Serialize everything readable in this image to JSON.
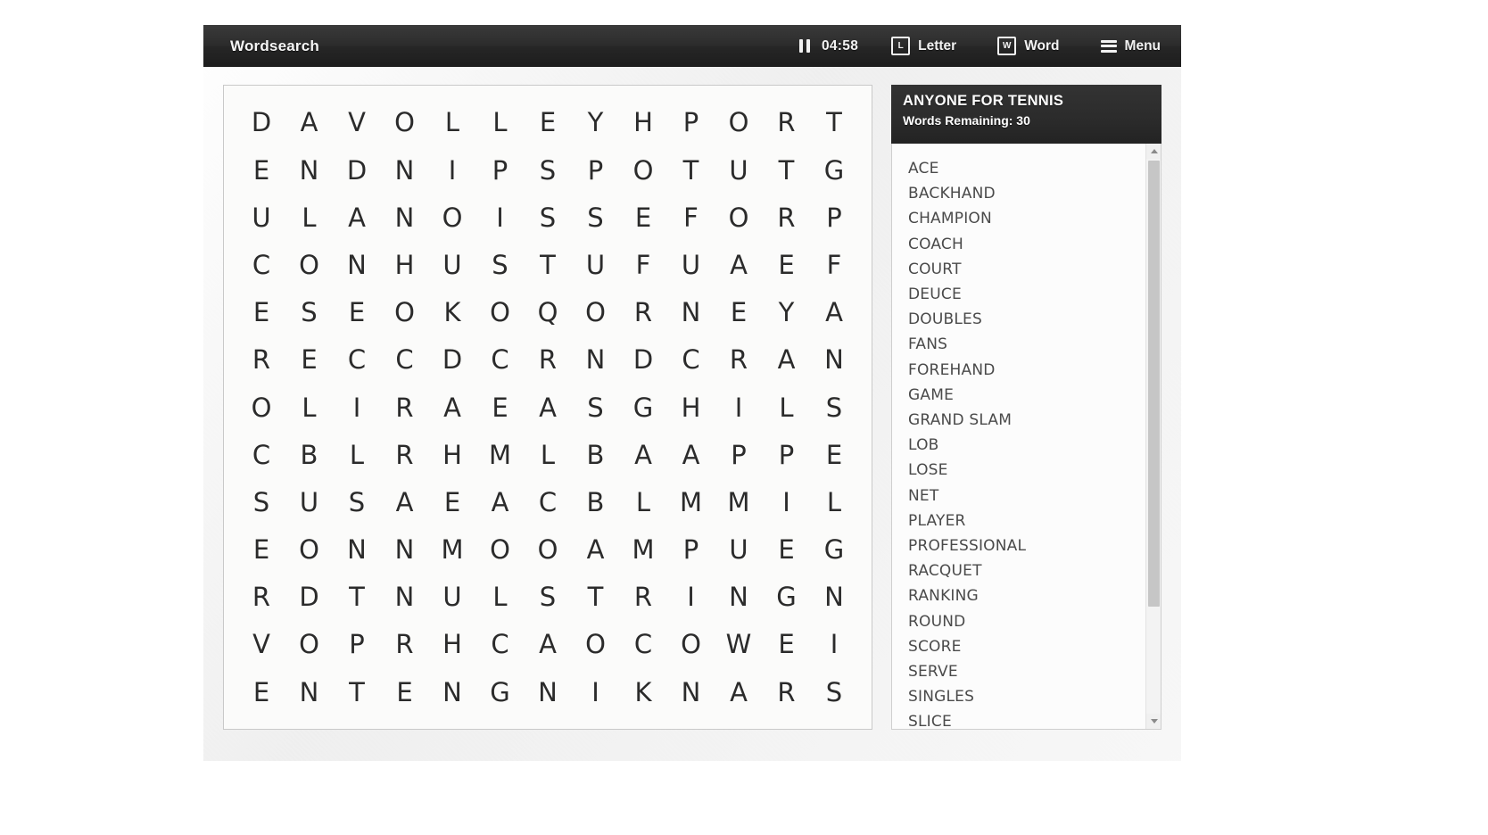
{
  "header": {
    "app_title": "Wordsearch",
    "pause_icon": "pause-icon",
    "timer": "04:58",
    "letter_hint_label": "Letter",
    "letter_hint_icon_glyph": "L",
    "word_hint_label": "Word",
    "word_hint_icon_glyph": "W",
    "menu_label": "Menu",
    "menu_icon": "hamburger-icon",
    "bar_color": "#2c2c2c",
    "text_color": "#f2f2f2"
  },
  "puzzle": {
    "columns": 13,
    "rows": 14,
    "grid": [
      [
        "D",
        "A",
        "V",
        "O",
        "L",
        "L",
        "E",
        "Y",
        "H",
        "P",
        "O",
        "R",
        "T"
      ],
      [
        "E",
        "N",
        "D",
        "N",
        "I",
        "P",
        "S",
        "P",
        "O",
        "T",
        "U",
        "T",
        "G"
      ],
      [
        "U",
        "L",
        "A",
        "N",
        "O",
        "I",
        "S",
        "S",
        "E",
        "F",
        "O",
        "R",
        "P"
      ],
      [
        "C",
        "O",
        "N",
        "H",
        "U",
        "S",
        "T",
        "U",
        "F",
        "U",
        "A",
        "E",
        "F"
      ],
      [
        "E",
        "S",
        "E",
        "O",
        "K",
        "O",
        "Q",
        "O",
        "R",
        "N",
        "E",
        "Y",
        "A"
      ],
      [
        "R",
        "E",
        "C",
        "C",
        "D",
        "C",
        "R",
        "N",
        "D",
        "C",
        "R",
        "A",
        "N"
      ],
      [
        "O",
        "L",
        "I",
        "R",
        "A",
        "E",
        "A",
        "S",
        "G",
        "H",
        "I",
        "L",
        "S"
      ],
      [
        "C",
        "B",
        "L",
        "R",
        "H",
        "M",
        "L",
        "B",
        "A",
        "A",
        "P",
        "P",
        "E"
      ],
      [
        "S",
        "U",
        "S",
        "A",
        "E",
        "A",
        "C",
        "B",
        "L",
        "M",
        "M",
        "I",
        "L"
      ],
      [
        "E",
        "O",
        "N",
        "N",
        "M",
        "O",
        "O",
        "A",
        "M",
        "P",
        "U",
        "E",
        "G"
      ],
      [
        "R",
        "D",
        "T",
        "N",
        "U",
        "L",
        "S",
        "T",
        "R",
        "I",
        "N",
        "G",
        "N"
      ],
      [
        "V",
        "O",
        "P",
        "R",
        "H",
        "C",
        "A",
        "O",
        "C",
        "O",
        "W",
        "E",
        "I"
      ],
      [
        "E",
        "N",
        "T",
        "E",
        "N",
        "G",
        "N",
        "I",
        "K",
        "N",
        "A",
        "R",
        "S"
      ]
    ]
  },
  "word_panel": {
    "title": "ANYONE FOR TENNIS",
    "remaining_label": "Words Remaining: 30",
    "words": [
      "ACE",
      "BACKHAND",
      "CHAMPION",
      "COACH",
      "COURT",
      "DEUCE",
      "DOUBLES",
      "FANS",
      "FOREHAND",
      "GAME",
      "GRAND SLAM",
      "LOB",
      "LOSE",
      "NET",
      "PLAYER",
      "PROFESSIONAL",
      "RACQUET",
      "RANKING",
      "ROUND",
      "SCORE",
      "SERVE",
      "SINGLES",
      "SLICE"
    ],
    "header_bg": "#2b2b2b",
    "word_color": "#4a4a4a"
  }
}
